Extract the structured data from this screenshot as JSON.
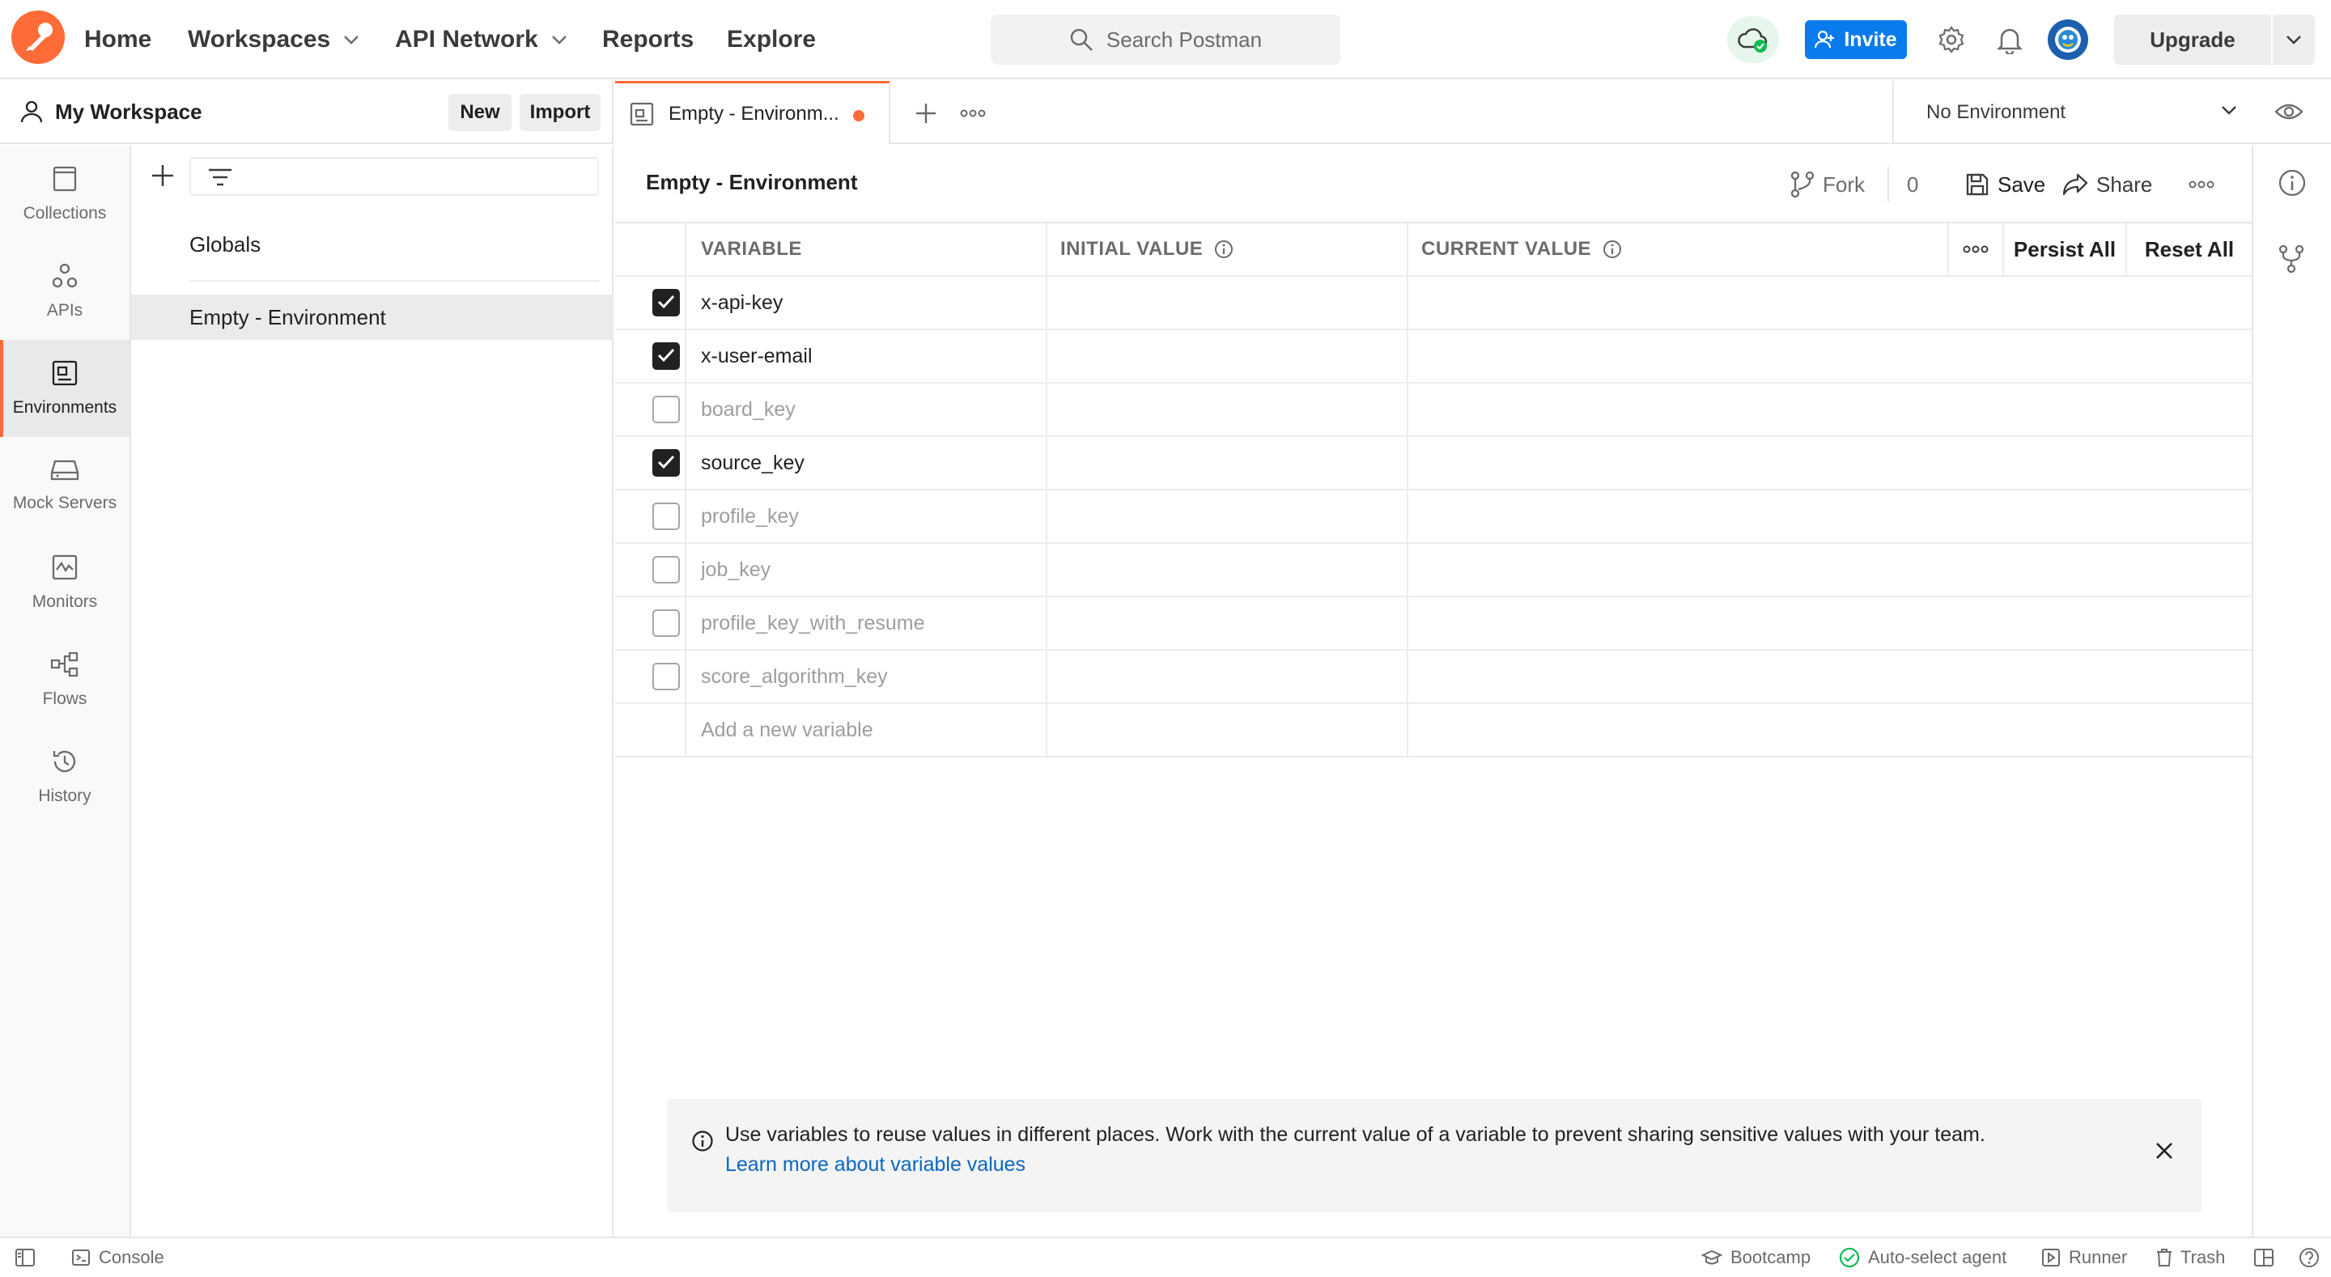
{
  "topnav": {
    "items": [
      {
        "label": "Home",
        "has_dropdown": false
      },
      {
        "label": "Workspaces",
        "has_dropdown": true
      },
      {
        "label": "API Network",
        "has_dropdown": true
      },
      {
        "label": "Reports",
        "has_dropdown": false
      },
      {
        "label": "Explore",
        "has_dropdown": false
      }
    ],
    "search_placeholder": "Search Postman",
    "invite_label": "Invite",
    "upgrade_label": "Upgrade",
    "icons": [
      "postman-logo",
      "cloud-sync-icon",
      "gear-icon",
      "bell-icon",
      "avatar"
    ]
  },
  "workspace": {
    "title": "My Workspace",
    "new_label": "New",
    "import_label": "Import"
  },
  "sidebar_nav": [
    {
      "label": "Collections",
      "icon": "collections-icon",
      "active": false
    },
    {
      "label": "APIs",
      "icon": "apis-icon",
      "active": false
    },
    {
      "label": "Environments",
      "icon": "environments-icon",
      "active": true
    },
    {
      "label": "Mock Servers",
      "icon": "mock-servers-icon",
      "active": false
    },
    {
      "label": "Monitors",
      "icon": "monitors-icon",
      "active": false
    },
    {
      "label": "Flows",
      "icon": "flows-icon",
      "active": false
    },
    {
      "label": "History",
      "icon": "history-icon",
      "active": false
    }
  ],
  "env_list": {
    "globals_label": "Globals",
    "items": [
      {
        "label": "Empty - Environment",
        "selected": true
      }
    ]
  },
  "tabs": {
    "active_tab_label": "Empty - Environm...",
    "unsaved": true,
    "environment_selector": "No Environment"
  },
  "environment": {
    "name": "Empty - Environment",
    "fork_label": "Fork",
    "fork_count": "0",
    "save_label": "Save",
    "share_label": "Share"
  },
  "table": {
    "headers": {
      "variable": "VARIABLE",
      "initial_value": "INITIAL VALUE",
      "current_value": "CURRENT VALUE",
      "persist_all": "Persist All",
      "reset_all": "Reset All"
    },
    "rows": [
      {
        "name": "x-api-key",
        "enabled": true,
        "initial": "",
        "current": ""
      },
      {
        "name": "x-user-email",
        "enabled": true,
        "initial": "",
        "current": ""
      },
      {
        "name": "board_key",
        "enabled": false,
        "initial": "",
        "current": ""
      },
      {
        "name": "source_key",
        "enabled": true,
        "initial": "",
        "current": ""
      },
      {
        "name": "profile_key",
        "enabled": false,
        "initial": "",
        "current": ""
      },
      {
        "name": "job_key",
        "enabled": false,
        "initial": "",
        "current": ""
      },
      {
        "name": "profile_key_with_resume",
        "enabled": false,
        "initial": "",
        "current": ""
      },
      {
        "name": "score_algorithm_key",
        "enabled": false,
        "initial": "",
        "current": ""
      }
    ],
    "add_placeholder": "Add a new variable"
  },
  "banner": {
    "text": "Use variables to reuse values in different places. Work with the current value of a variable to prevent sharing sensitive values with your team. ",
    "link": "Learn more about variable values"
  },
  "statusbar": {
    "console": "Console",
    "bootcamp": "Bootcamp",
    "auto_select_agent": "Auto-select agent",
    "runner": "Runner",
    "trash": "Trash"
  },
  "colors": {
    "brand": "#ff6c37",
    "primary": "#097bed",
    "link": "#0b66c3",
    "sync_ok": "#0cbb52"
  }
}
